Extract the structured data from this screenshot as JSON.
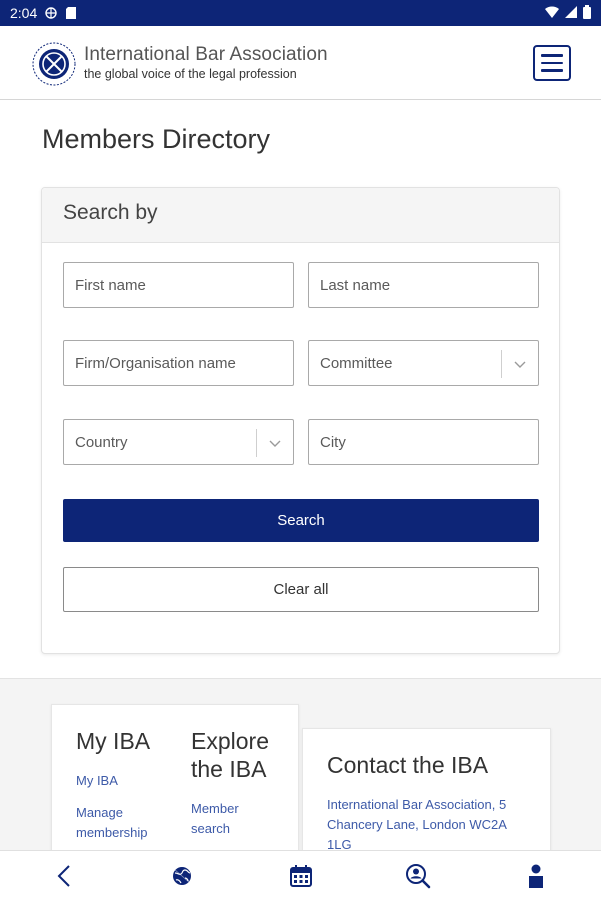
{
  "status_bar": {
    "time": "2:04"
  },
  "header": {
    "org_name": "International Bar Association",
    "tagline": "the global voice of the legal profession"
  },
  "page": {
    "title": "Members Directory"
  },
  "search_card": {
    "title": "Search by",
    "first_name_placeholder": "First name",
    "last_name_placeholder": "Last name",
    "firm_placeholder": "Firm/Organisation name",
    "committee_label": "Committee",
    "country_label": "Country",
    "city_placeholder": "City",
    "search_label": "Search",
    "clear_label": "Clear all"
  },
  "footer": {
    "my_iba": {
      "heading": "My IBA",
      "links": [
        "My IBA",
        "Manage membership"
      ]
    },
    "explore": {
      "heading": "Explore the IBA",
      "links": [
        "Member search"
      ]
    },
    "contact": {
      "heading": "Contact the IBA",
      "address": "International Bar Association, 5 Chancery Lane, London WC2A 1LG"
    }
  },
  "bottom_nav": {
    "items": [
      "back-icon",
      "globe-icon",
      "calendar-icon",
      "search-person-icon",
      "person-icon"
    ]
  },
  "colors": {
    "brand": "#0d2577",
    "link": "#3d5aa8"
  }
}
